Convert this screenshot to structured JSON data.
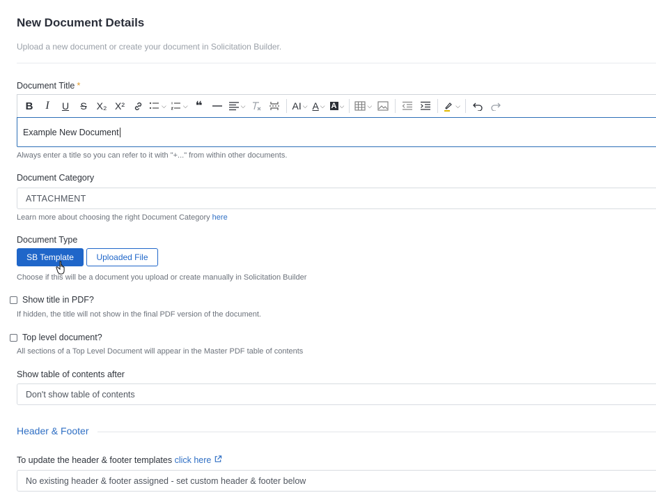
{
  "page": {
    "title": "New Document Details",
    "subtitle": "Upload a new document or create your document in Solicitation Builder."
  },
  "doc_title": {
    "label": "Document Title",
    "required_mark": "*",
    "value": "Example New Document",
    "help": "Always enter a title so you can refer to it with \"+...\" from within other documents."
  },
  "toolbar": {
    "bold": "B",
    "italic": "I",
    "underline": "U",
    "strike": "S",
    "sub": "X₂",
    "sup": "X²",
    "quote": "❝",
    "text_size": "AI",
    "font_color": "A",
    "highlight_bg": "A"
  },
  "category": {
    "label": "Document Category",
    "value": "ATTACHMENT",
    "help_prefix": "Learn more about choosing the right Document Category",
    "help_link": "here"
  },
  "doc_type": {
    "label": "Document Type",
    "option_a": "SB Template",
    "option_b": "Uploaded File",
    "help": "Choose if this will be a document you upload or create manually in Solicitation Builder"
  },
  "show_title": {
    "label": "Show title in PDF?",
    "help": "If hidden, the title will not show in the final PDF version of the document."
  },
  "top_level": {
    "label": "Top level document?",
    "help": "All sections of a Top Level Document will appear in the Master PDF table of contents"
  },
  "toc": {
    "label": "Show table of contents after",
    "value": "Don't show table of contents"
  },
  "header_footer": {
    "heading": "Header & Footer",
    "update_prefix": "To update the header & footer templates",
    "update_link": "click here",
    "value": "No existing header & footer assigned - set custom header & footer below"
  },
  "colors": {
    "primary": "#1f66c9",
    "link": "#2f6fc4",
    "required": "#e09a2a"
  }
}
